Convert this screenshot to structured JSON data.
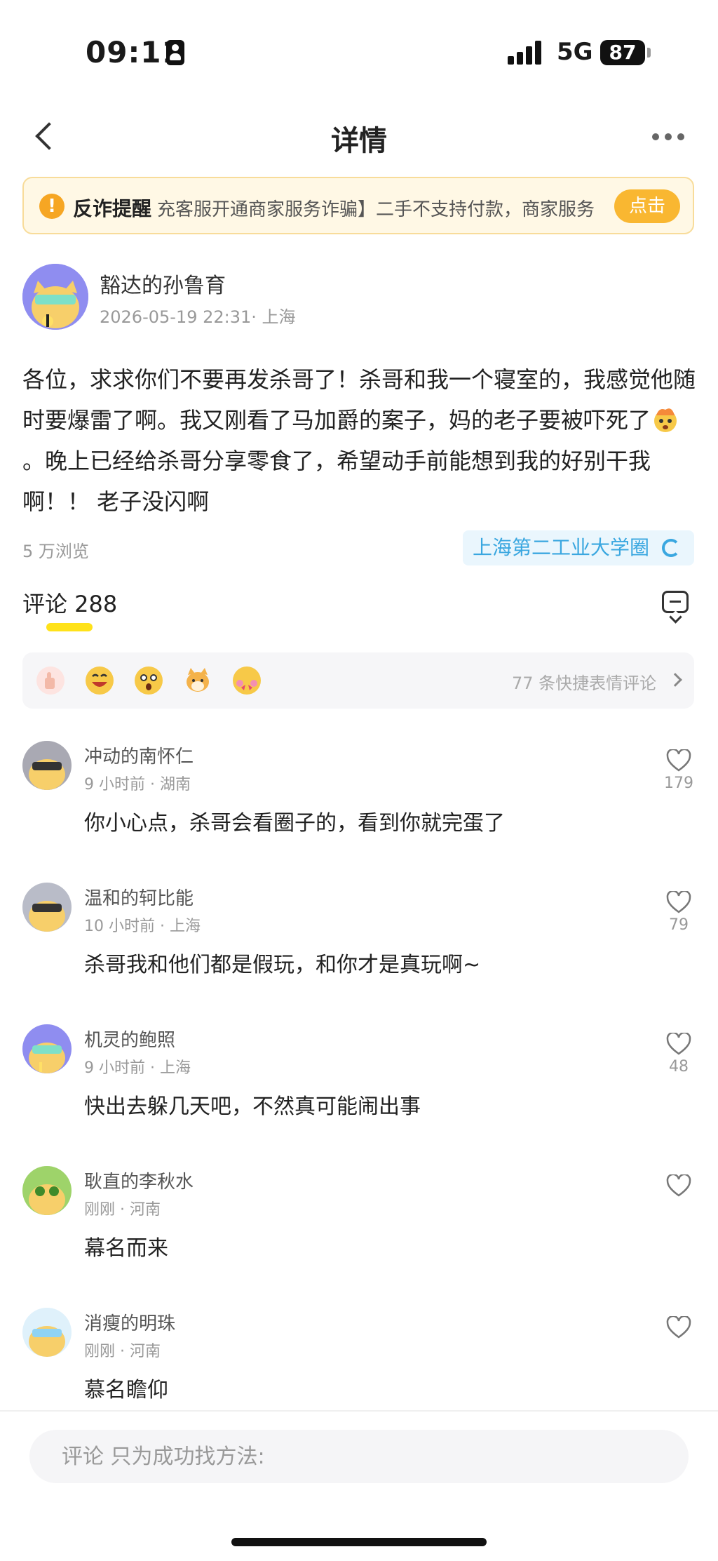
{
  "status_bar": {
    "time": "09:11",
    "network": "5G",
    "battery": "87"
  },
  "nav": {
    "title": "详情"
  },
  "banner": {
    "title": "反诈提醒",
    "text": "充客服开通商家服务诈骗】二手不支持付款，商家服务",
    "button": "点击"
  },
  "post": {
    "author": "豁达的孙鲁育",
    "meta": "2026-05-19 22:31· 上海",
    "body_part1": "各位，求求你们不要再发杀哥了！杀哥和我一个寝室的，我感觉他随时要爆雷了啊。我又刚看了马加爵的案子，妈的老子要被吓死了",
    "body_part2": "。晚上已经给杀哥分享零食了，希望动手前能想到我的好别干我啊！！ 老子没闪啊",
    "views": "5 万浏览",
    "circle": "上海第二工业大学圈"
  },
  "comments_section": {
    "header": "评论 288",
    "reaction_count": "77 条快捷表情评论",
    "reaction_icons": [
      "thumbs-up-emoji",
      "grin-emoji",
      "surprised-emoji",
      "dog-emoji",
      "heart-face-emoji"
    ]
  },
  "comments": [
    {
      "name": "冲动的南怀仁",
      "meta": "9 小时前 · 湖南",
      "text": "你小心点，杀哥会看圈子的，看到你就完蛋了",
      "likes": "179"
    },
    {
      "name": "温和的轲比能",
      "meta": "10 小时前 · 上海",
      "text": "杀哥我和他们都是假玩，和你才是真玩啊~",
      "likes": "79"
    },
    {
      "name": "机灵的鲍照",
      "meta": "9 小时前 · 上海",
      "text": "快出去躲几天吧，不然真可能闹出事",
      "likes": "48"
    },
    {
      "name": "耿直的李秋水",
      "meta": "刚刚 · 河南",
      "text": "幕名而来",
      "likes": ""
    },
    {
      "name": "消瘦的明珠",
      "meta": "刚刚 · 河南",
      "text": "慕名瞻仰",
      "likes": ""
    }
  ],
  "input": {
    "placeholder": "评论 只为成功找方法:"
  },
  "colors": {
    "accent_yellow": "#f9b731",
    "link_blue": "#3aa7e0",
    "underline_yellow": "#ffe21a"
  }
}
